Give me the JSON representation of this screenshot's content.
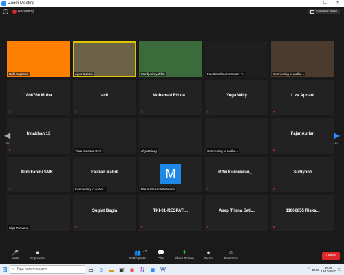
{
  "window": {
    "title": "Zoom Meeting",
    "minimize": "–",
    "maximize": "☐",
    "close": "✕"
  },
  "topbar": {
    "recording": "Recording",
    "speaker_view": "Speaker View"
  },
  "tiles": [
    {
      "label": "Rafli Saptiana",
      "name": "",
      "bg": "#ff7f00"
    },
    {
      "label": "Agus Sulistio",
      "name": "",
      "bg": "#6b6248",
      "active": true
    },
    {
      "label": "Mardjuki Syahfitri",
      "name": "",
      "bg": "#3b6b3a"
    },
    {
      "label": "Fakultas Ilmu Komputer P...",
      "name": "",
      "bg": "#1e1e1e"
    },
    {
      "label": "Connecting to audio ...",
      "name": "",
      "bg": "#4a3b2e"
    },
    {
      "label": "",
      "name": "11806760  Muha...",
      "bg": "#222"
    },
    {
      "label": "",
      "name": "acil",
      "bg": "#222"
    },
    {
      "label": "",
      "name": "Muhamad  Rizkia...",
      "bg": "#222"
    },
    {
      "label": "",
      "name": "Yoga Willy",
      "bg": "#222"
    },
    {
      "label": "",
      "name": "Liza Apriani",
      "bg": "#222"
    },
    {
      "label": "",
      "name": "Innakhan 13",
      "bg": "#222"
    },
    {
      "label": "Tiara Kurasna Devi",
      "name": "",
      "bg": "#222"
    },
    {
      "label": "ahyat triady",
      "name": "",
      "bg": "#222"
    },
    {
      "label": "Connecting to audio ...",
      "name": "",
      "bg": "#222"
    },
    {
      "label": "",
      "name": "Fajar Aprian",
      "bg": "#222"
    },
    {
      "label": "",
      "name": "Alim  Fahmi  SMK...",
      "bg": "#222"
    },
    {
      "label": "Connecting to audio ...",
      "name": "Fauzan Mahdi",
      "bg": "#222"
    },
    {
      "label": "Maria Shusanti Febrianti",
      "name": "",
      "bg": "#222",
      "avatar": "M"
    },
    {
      "label": "",
      "name": "Rifki  Kurniawan_...",
      "bg": "#222"
    },
    {
      "label": "",
      "name": "Sudiyono",
      "bg": "#222"
    },
    {
      "label": "Sigit Purnama",
      "name": "",
      "bg": "#222"
    },
    {
      "label": "",
      "name": "Sugiat Bagja",
      "bg": "#222"
    },
    {
      "label": "",
      "name": "TKI-01-RESPATI...",
      "bg": "#222"
    },
    {
      "label": "",
      "name": "Asep  Trisna  Seti...",
      "bg": "#222"
    },
    {
      "label": "",
      "name": "11806855  Riska...",
      "bg": "#222"
    }
  ],
  "pagination": {
    "left": "1/2",
    "right": "1/2"
  },
  "toolbar": {
    "mute": "Mute",
    "stop_video": "Stop Video",
    "participants": "Participants",
    "participant_count": "42",
    "chat": "Chat",
    "share_screen": "Share Screen",
    "record": "Record",
    "reactions": "Reactions",
    "leave": "Leave"
  },
  "taskbar": {
    "search_placeholder": "Type here to search",
    "language": "ENG",
    "time": "10:08",
    "date": "19/10/2020"
  },
  "colors": {
    "accent": "#2d8cff",
    "record": "#e02828",
    "active_border": "#e0c400",
    "share_green": "#2ecc40"
  }
}
